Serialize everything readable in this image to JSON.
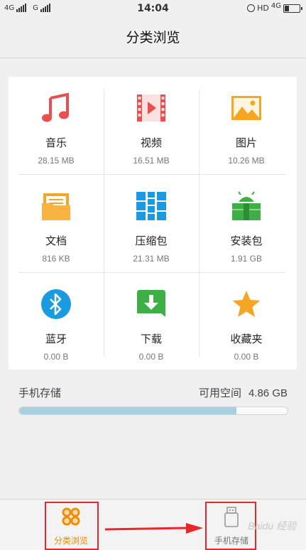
{
  "status_bar": {
    "net1": "4G",
    "net2": "G",
    "time": "14:04",
    "hd": "HD",
    "net3": "4G"
  },
  "header": {
    "title": "分类浏览"
  },
  "categories": [
    {
      "label": "音乐",
      "size": "28.15 MB",
      "icon": "music-note-icon",
      "color": "#ea4e4e"
    },
    {
      "label": "视频",
      "size": "16.51 MB",
      "icon": "film-icon",
      "color": "#ea4e4e"
    },
    {
      "label": "图片",
      "size": "10.26 MB",
      "icon": "picture-icon",
      "color": "#f6a623"
    },
    {
      "label": "文档",
      "size": "816 KB",
      "icon": "folder-document-icon",
      "color": "#f6a623"
    },
    {
      "label": "压缩包",
      "size": "21.31 MB",
      "icon": "archive-icon",
      "color": "#1a9ae0"
    },
    {
      "label": "安装包",
      "size": "1.91 GB",
      "icon": "android-icon",
      "color": "#3eaf45"
    },
    {
      "label": "蓝牙",
      "size": "0.00 B",
      "icon": "bluetooth-icon",
      "color": "#1a9ae0"
    },
    {
      "label": "下载",
      "size": "0.00 B",
      "icon": "download-icon",
      "color": "#3eaf45"
    },
    {
      "label": "收藏夹",
      "size": "0.00 B",
      "icon": "star-icon",
      "color": "#f6a623"
    }
  ],
  "storage": {
    "label": "手机存储",
    "free_label": "可用空间",
    "free_value": "4.86 GB",
    "used_fraction": 0.81
  },
  "bottom_nav": [
    {
      "label": "分类浏览",
      "icon": "category-grid-icon",
      "active": true
    },
    {
      "label": "手机存储",
      "icon": "usb-storage-icon",
      "active": false
    }
  ],
  "watermark": "Baidu 经验",
  "colors": {
    "active": "#f08c00",
    "annotation": "#e8272b",
    "storage_fill": "#a9d0e0"
  }
}
